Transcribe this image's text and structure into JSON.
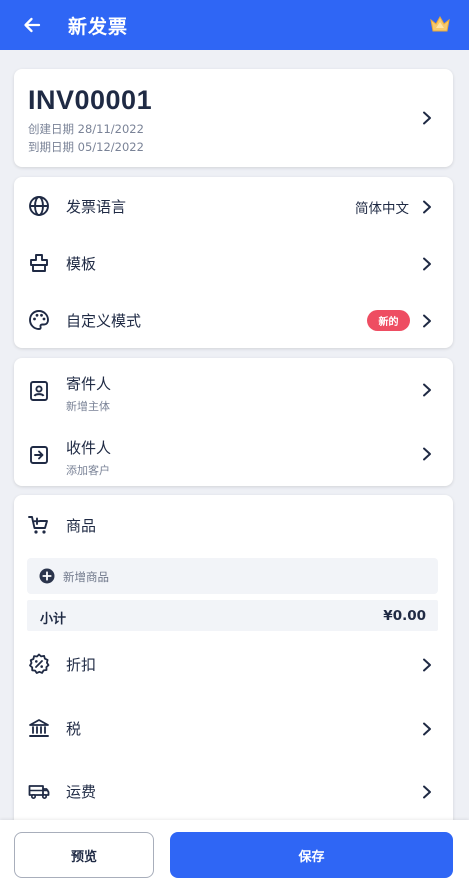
{
  "colors": {
    "primary": "#2f66f5",
    "badge": "#ee4d62",
    "text": "#1f2a44",
    "muted": "#7a8397"
  },
  "header": {
    "title": "新发票",
    "back_icon": "back-arrow-icon",
    "premium_icon": "crown-icon"
  },
  "invoice": {
    "number": "INV00001",
    "created": "创建日期 28/11/2022",
    "due": "到期日期 05/12/2022"
  },
  "settings": {
    "language_label": "发票语言",
    "language_value": "简体中文",
    "template_label": "模板",
    "custom_style_label": "自定义模式",
    "custom_style_badge": "新的"
  },
  "parties": {
    "sender_label": "寄件人",
    "sender_sub": "新增主体",
    "recipient_label": "收件人",
    "recipient_sub": "添加客户"
  },
  "items": {
    "title": "商品",
    "add_item": "新增商品",
    "subtotal_label": "小计",
    "subtotal_value": "¥0.00",
    "discount_label": "折扣",
    "tax_label": "税",
    "shipping_label": "运费"
  },
  "footer": {
    "preview_label": "预览",
    "save_label": "保存"
  }
}
